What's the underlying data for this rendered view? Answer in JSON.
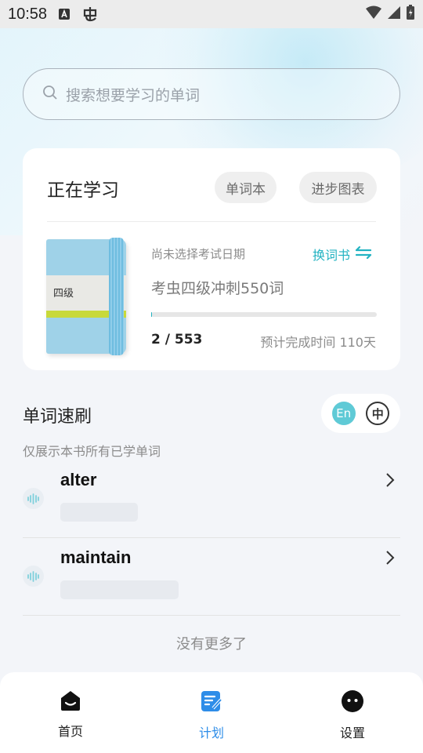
{
  "status_bar": {
    "time": "10:58",
    "icons": [
      "accessibility-a-icon",
      "bug-icon",
      "wifi-icon",
      "cellular-signal-icon",
      "battery-icon"
    ]
  },
  "search": {
    "placeholder": "搜索想要学习的单词",
    "icon": "search-icon"
  },
  "study_card": {
    "title": "正在学习",
    "wordbook_button": "单词本",
    "progress_chart_button": "进步图表",
    "book_cover_label": "四级",
    "exam_date_status": "尚未选择考试日期",
    "switch_book_label": "换词书",
    "book_name": "考虫四级冲刺550词",
    "progress_fraction": 0.0036,
    "progress_count": "2 / 553",
    "estimated_finish": "预计完成时间 110天",
    "accent_color": "#23b3c2"
  },
  "quick_review": {
    "title": "单词速刷",
    "subtitle": "仅展示本书所有已学单词",
    "lang_en": "En",
    "lang_zh": "中",
    "words": [
      {
        "word": "alter"
      },
      {
        "word": "maintain"
      }
    ],
    "end_text": "没有更多了"
  },
  "tabbar": {
    "active_color": "#2e8de8",
    "tabs": [
      {
        "label": "首页",
        "icon": "home-icon",
        "active": false
      },
      {
        "label": "计划",
        "icon": "plan-icon",
        "active": true
      },
      {
        "label": "设置",
        "icon": "settings-face-icon",
        "active": false
      }
    ]
  }
}
